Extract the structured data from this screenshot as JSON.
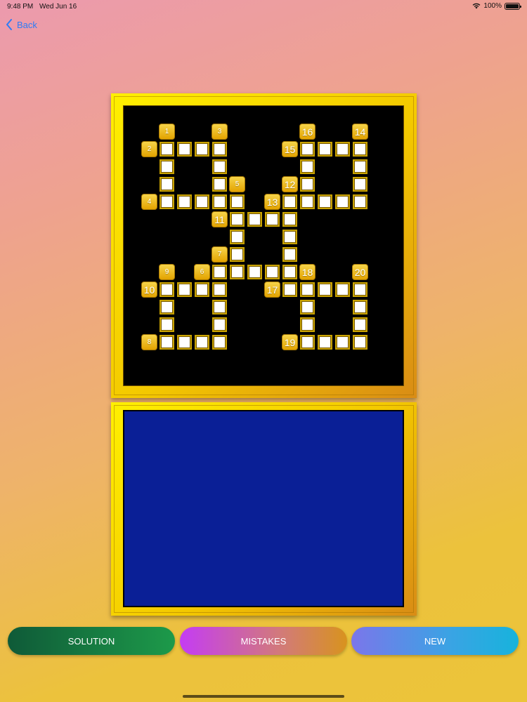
{
  "status_bar": {
    "time": "9:48 PM",
    "date": "Wed Jun 16",
    "battery": "100%"
  },
  "nav": {
    "back_label": "Back",
    "back_icon": "chevron-left-icon"
  },
  "colors": {
    "accent": "#2d7cf6",
    "board_bg": "#000000",
    "clue_panel_bg": "#0a1f96",
    "frame_gold": "#f3c800"
  },
  "puzzle": {
    "grid_size": 16,
    "numbers": [
      {
        "label": "1",
        "row": 1,
        "col": 2
      },
      {
        "label": "3",
        "row": 1,
        "col": 5
      },
      {
        "label": "16",
        "row": 1,
        "col": 10
      },
      {
        "label": "14",
        "row": 1,
        "col": 13
      },
      {
        "label": "2",
        "row": 2,
        "col": 1
      },
      {
        "label": "15",
        "row": 2,
        "col": 9
      },
      {
        "label": "5",
        "row": 4,
        "col": 6
      },
      {
        "label": "12",
        "row": 4,
        "col": 9
      },
      {
        "label": "4",
        "row": 5,
        "col": 1
      },
      {
        "label": "13",
        "row": 5,
        "col": 8
      },
      {
        "label": "11",
        "row": 6,
        "col": 5
      },
      {
        "label": "7",
        "row": 8,
        "col": 5
      },
      {
        "label": "9",
        "row": 9,
        "col": 2
      },
      {
        "label": "6",
        "row": 9,
        "col": 4
      },
      {
        "label": "18",
        "row": 9,
        "col": 10
      },
      {
        "label": "20",
        "row": 9,
        "col": 13
      },
      {
        "label": "10",
        "row": 10,
        "col": 1
      },
      {
        "label": "17",
        "row": 10,
        "col": 8
      },
      {
        "label": "8",
        "row": 13,
        "col": 1
      },
      {
        "label": "19",
        "row": 13,
        "col": 9
      }
    ],
    "cells": [
      [
        2,
        2
      ],
      [
        2,
        3
      ],
      [
        2,
        4
      ],
      [
        2,
        5
      ],
      [
        3,
        2
      ],
      [
        4,
        2
      ],
      [
        5,
        2
      ],
      [
        5,
        3
      ],
      [
        5,
        4
      ],
      [
        5,
        5
      ],
      [
        3,
        5
      ],
      [
        4,
        5
      ],
      [
        5,
        6
      ],
      [
        6,
        6
      ],
      [
        7,
        6
      ],
      [
        8,
        6
      ],
      [
        9,
        6
      ],
      [
        6,
        7
      ],
      [
        6,
        8
      ],
      [
        6,
        9
      ],
      [
        2,
        10
      ],
      [
        2,
        11
      ],
      [
        2,
        12
      ],
      [
        2,
        13
      ],
      [
        3,
        10
      ],
      [
        4,
        10
      ],
      [
        5,
        10
      ],
      [
        5,
        11
      ],
      [
        5,
        12
      ],
      [
        5,
        13
      ],
      [
        3,
        13
      ],
      [
        4,
        13
      ],
      [
        5,
        9
      ],
      [
        7,
        9
      ],
      [
        8,
        9
      ],
      [
        9,
        9
      ],
      [
        9,
        5
      ],
      [
        9,
        7
      ],
      [
        9,
        8
      ],
      [
        10,
        2
      ],
      [
        10,
        3
      ],
      [
        10,
        4
      ],
      [
        10,
        5
      ],
      [
        11,
        2
      ],
      [
        12,
        2
      ],
      [
        13,
        2
      ],
      [
        13,
        3
      ],
      [
        13,
        4
      ],
      [
        13,
        5
      ],
      [
        11,
        5
      ],
      [
        12,
        5
      ],
      [
        10,
        9
      ],
      [
        10,
        10
      ],
      [
        10,
        11
      ],
      [
        10,
        12
      ],
      [
        10,
        13
      ],
      [
        11,
        10
      ],
      [
        12,
        10
      ],
      [
        13,
        10
      ],
      [
        13,
        11
      ],
      [
        13,
        12
      ],
      [
        13,
        13
      ],
      [
        11,
        13
      ],
      [
        12,
        13
      ]
    ]
  },
  "buttons": {
    "solution": "SOLUTION",
    "mistakes": "MISTAKES",
    "new": "NEW"
  }
}
